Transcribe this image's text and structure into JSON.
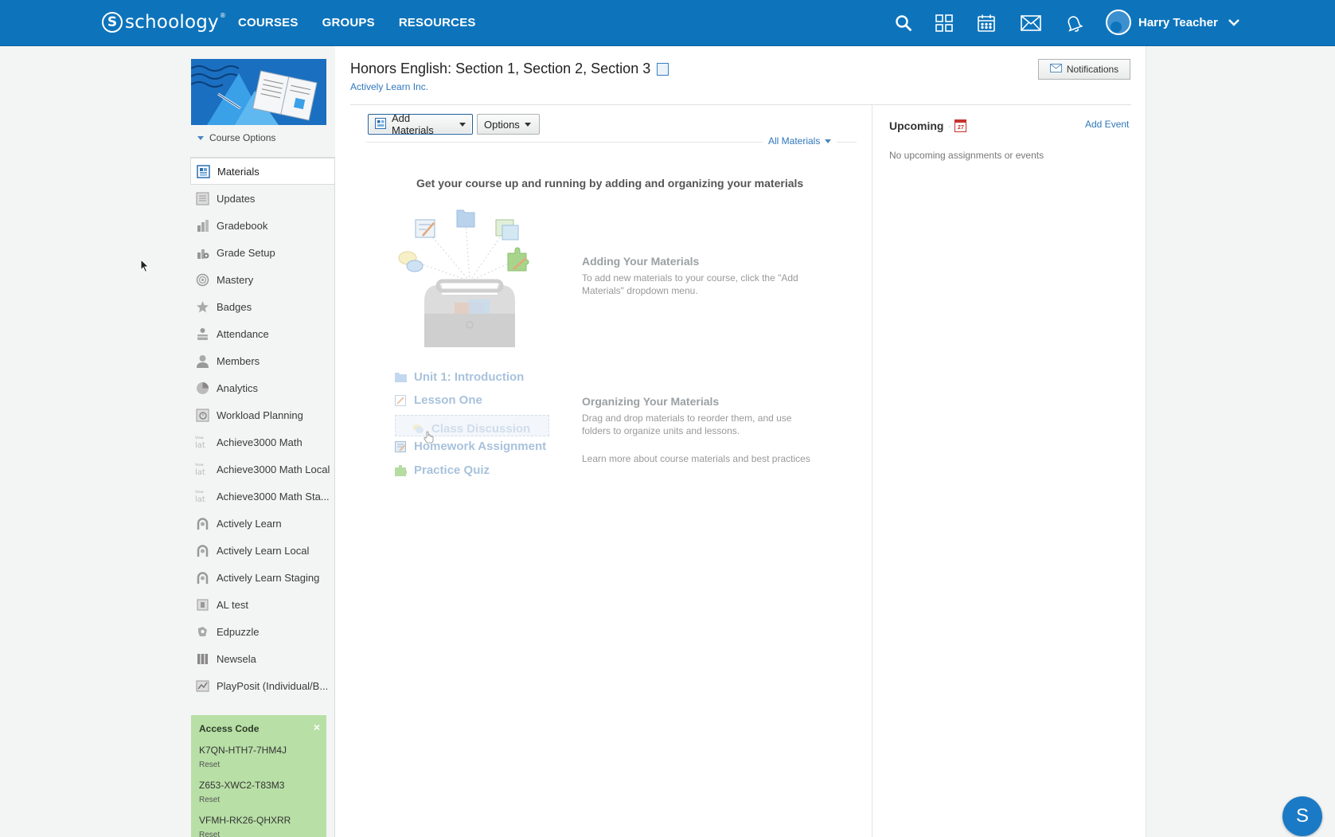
{
  "header": {
    "brand": "schoology",
    "brand_mark": "S",
    "brand_tm": "®",
    "nav": [
      "COURSES",
      "GROUPS",
      "RESOURCES"
    ],
    "user_name": "Harry Teacher",
    "icons": [
      "search-icon",
      "apps-grid-icon",
      "calendar-icon",
      "mail-icon",
      "bell-icon"
    ]
  },
  "sidebar": {
    "course_options": "Course Options",
    "items": [
      {
        "label": "Materials",
        "icon": "materials-icon",
        "active": true
      },
      {
        "label": "Updates",
        "icon": "updates-icon"
      },
      {
        "label": "Gradebook",
        "icon": "gradebook-icon"
      },
      {
        "label": "Grade Setup",
        "icon": "grade-setup-icon"
      },
      {
        "label": "Mastery",
        "icon": "mastery-icon"
      },
      {
        "label": "Badges",
        "icon": "badge-icon"
      },
      {
        "label": "Attendance",
        "icon": "attendance-icon"
      },
      {
        "label": "Members",
        "icon": "members-icon"
      },
      {
        "label": "Analytics",
        "icon": "analytics-icon"
      },
      {
        "label": "Workload Planning",
        "icon": "workload-icon"
      },
      {
        "label": "Achieve3000 Math",
        "icon": "achieve-icon"
      },
      {
        "label": "Achieve3000 Math Local",
        "icon": "achieve-icon"
      },
      {
        "label": "Achieve3000 Math Sta...",
        "icon": "achieve-icon"
      },
      {
        "label": "Actively Learn",
        "icon": "actively-learn-icon"
      },
      {
        "label": "Actively Learn Local",
        "icon": "actively-learn-icon"
      },
      {
        "label": "Actively Learn Staging",
        "icon": "actively-learn-icon"
      },
      {
        "label": "AL test",
        "icon": "app-icon"
      },
      {
        "label": "Edpuzzle",
        "icon": "edpuzzle-icon"
      },
      {
        "label": "Newsela",
        "icon": "newsela-icon"
      },
      {
        "label": "PlayPosit (Individual/B...",
        "icon": "playposit-icon"
      }
    ],
    "access_code": {
      "title": "Access Code",
      "close": "×",
      "codes": [
        {
          "code": "K7QN-HTH7-7HM4J",
          "reset": "Reset"
        },
        {
          "code": "Z653-XWC2-T83M3",
          "reset": "Reset"
        },
        {
          "code": "VFMH-RK26-QHXRR",
          "reset": "Reset"
        }
      ]
    }
  },
  "main": {
    "title": "Honors English: Section 1, Section 2, Section 3",
    "subtitle": "Actively Learn Inc.",
    "notifications_button": "Notifications",
    "add_materials": "Add Materials",
    "options": "Options",
    "filter": "All Materials",
    "empty_heading": "Get your course up and running by adding and organizing your materials",
    "adding": {
      "title": "Adding Your Materials",
      "text": "To add new materials to your course, click the \"Add Materials\" dropdown menu."
    },
    "organizing": {
      "title": "Organizing Your Materials",
      "text": "Drag and drop materials to reorder them, and use folders to organize units and lessons."
    },
    "learn_more": "Learn more about course materials and best practices",
    "demo_items": [
      "Unit 1: Introduction",
      "Lesson One",
      "Class Discussion",
      "Homework Assignment",
      "Practice Quiz"
    ]
  },
  "upcoming": {
    "title": "Upcoming",
    "separator": "·",
    "calendar_day": "27",
    "add_event": "Add Event",
    "empty": "No upcoming assignments or events"
  },
  "support_button": "S",
  "colors": {
    "header_bg": "#0d74bc",
    "link": "#2f77bb",
    "access_bg": "#b8dfa6"
  }
}
